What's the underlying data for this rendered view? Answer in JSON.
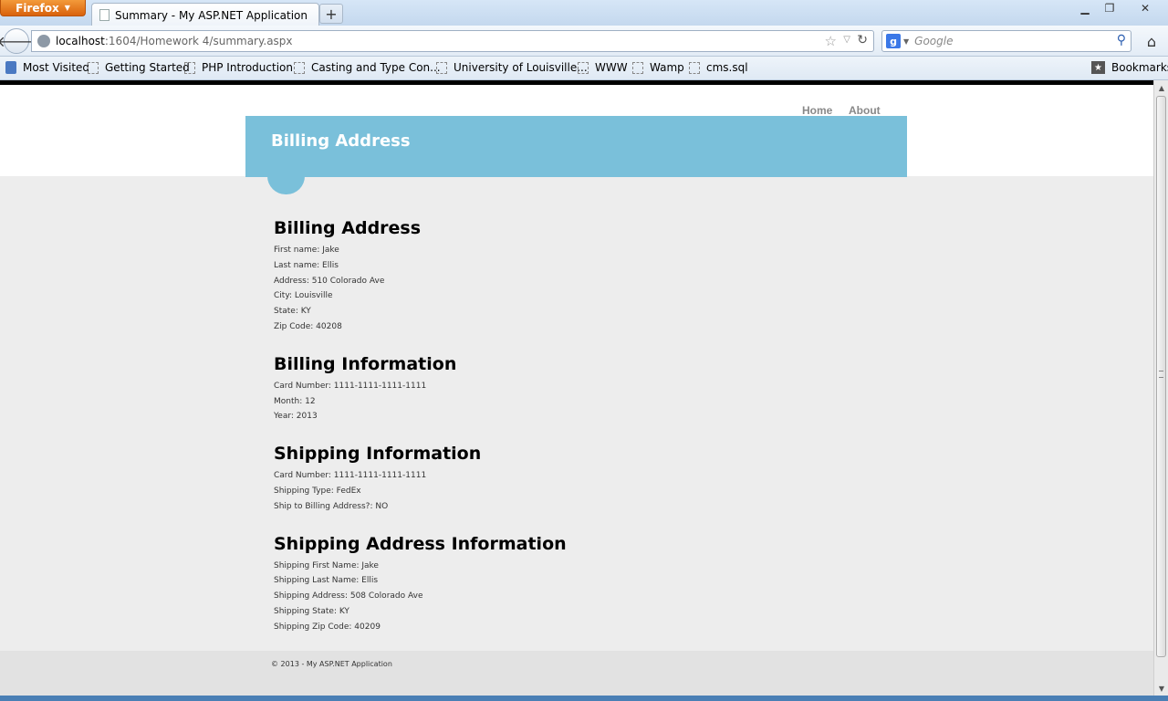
{
  "browser": {
    "app_button": "Firefox",
    "tab_title": "Summary - My ASP.NET Application",
    "new_tab": "+",
    "url_host": "localhost",
    "url_rest": ":1604/Homework 4/summary.aspx",
    "search_placeholder": "Google",
    "bookmarks": [
      "Most Visited",
      "Getting Started",
      "PHP Introduction",
      "Casting and Type Con...",
      "University of Louisville...",
      "WWW",
      "Wamp",
      "cms.sql"
    ],
    "bookmarks_menu": "Bookmarks"
  },
  "site": {
    "menu": [
      "Home",
      "About"
    ],
    "banner_title": "Billing Address",
    "footer": "© 2013 - My ASP.NET Application"
  },
  "sections": [
    {
      "heading": "Billing Address",
      "fields": [
        "First name: Jake",
        "Last name: Ellis",
        "Address: 510 Colorado Ave",
        "City: Louisville",
        "State: KY",
        "Zip Code: 40208"
      ]
    },
    {
      "heading": "Billing Information",
      "fields": [
        "Card Number: 1111-1111-1111-1111",
        "Month: 12",
        "Year: 2013"
      ]
    },
    {
      "heading": "Shipping Information",
      "fields": [
        "Card Number: 1111-1111-1111-1111",
        "Shipping Type: FedEx",
        "Ship to Billing Address?: NO"
      ]
    },
    {
      "heading": "Shipping Address Information",
      "fields": [
        "Shipping First Name: Jake",
        "Shipping Last Name: Ellis",
        "Shipping Address: 508 Colorado Ave",
        "Shipping State: KY",
        "Shipping Zip Code: 40209"
      ]
    }
  ]
}
